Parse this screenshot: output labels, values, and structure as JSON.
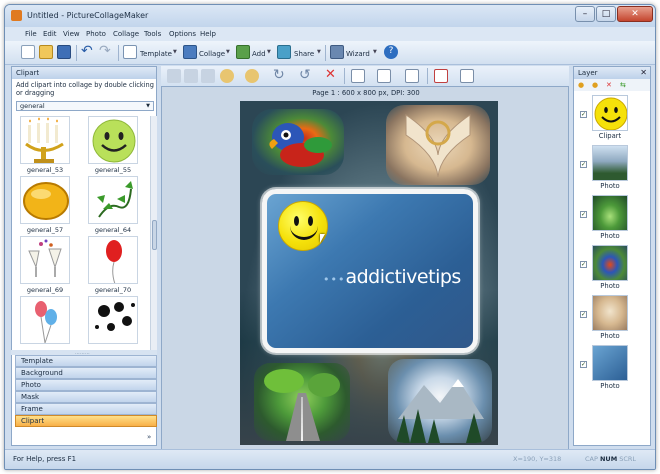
{
  "window": {
    "title": "Untitled - PictureCollageMaker",
    "min": "–",
    "max": "□",
    "close": "✕"
  },
  "menu": [
    "File",
    "Edit",
    "View",
    "Photo",
    "Collage",
    "Tools",
    "Options",
    "Help"
  ],
  "toolbar": {
    "template": "Template",
    "collage": "Collage",
    "add": "Add",
    "share": "Share",
    "wizard": "Wizard"
  },
  "clipart_panel": {
    "title": "Clipart",
    "hint": "Add clipart into collage by double clicking or dragging",
    "category": "general",
    "items": [
      {
        "caption": "general_53",
        "icon": "candles"
      },
      {
        "caption": "general_55",
        "icon": "smiley"
      },
      {
        "caption": "general_57",
        "icon": "gold-oval"
      },
      {
        "caption": "general_64",
        "icon": "vine"
      },
      {
        "caption": "general_69",
        "icon": "glasses"
      },
      {
        "caption": "general_70",
        "icon": "balloon"
      },
      {
        "caption": "",
        "icon": "balloons"
      },
      {
        "caption": "",
        "icon": "black-balloons"
      }
    ]
  },
  "nav_buttons": [
    "Template",
    "Background",
    "Photo",
    "Mask",
    "Frame",
    "Clipart"
  ],
  "active_nav": "Clipart",
  "canvas": {
    "page_info": "Page 1 : 600 x 800 px, DPI: 300",
    "brand": "addictivetips",
    "brand_dots": "•••"
  },
  "layer_panel": {
    "title": "Layer",
    "items": [
      {
        "caption": "Clipart",
        "checked": true
      },
      {
        "caption": "Photo",
        "checked": true
      },
      {
        "caption": "Photo",
        "checked": true
      },
      {
        "caption": "Photo",
        "checked": true
      },
      {
        "caption": "Photo",
        "checked": true
      },
      {
        "caption": "Photo",
        "checked": true
      }
    ]
  },
  "status": {
    "help": "For Help, press F1",
    "coords": "X=190, Y=318",
    "cap": "CAP",
    "num": "NUM",
    "scrl": "SCRL"
  },
  "colors": {
    "accent": "#3d79b1",
    "active_tab": "#f8b048"
  }
}
